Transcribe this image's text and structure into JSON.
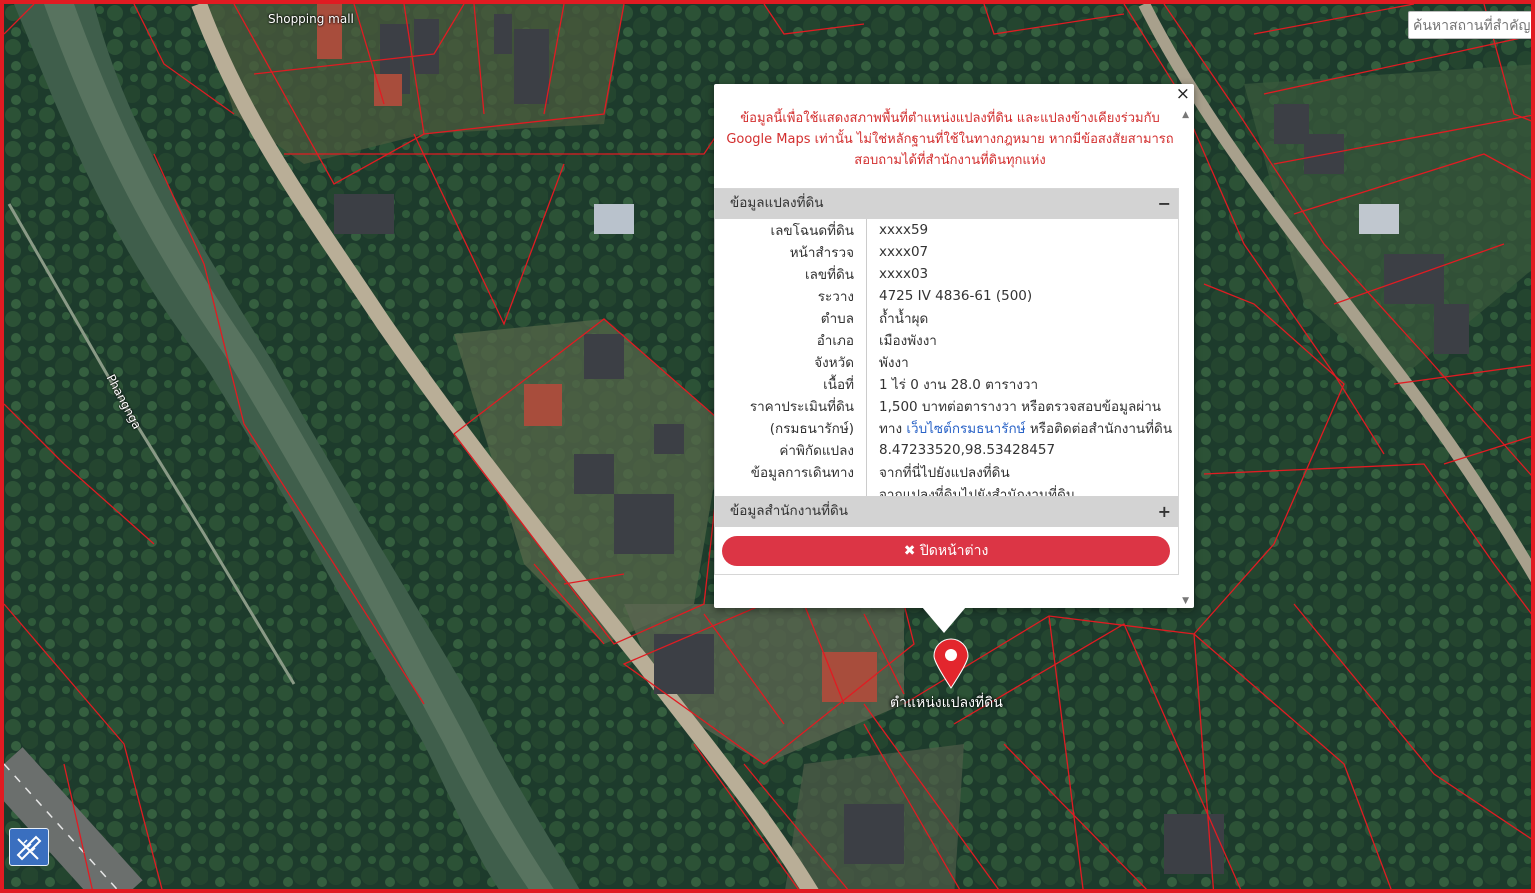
{
  "map": {
    "river_label": "Phangnga",
    "poi_label": "Shopping mall",
    "search_placeholder": "ค้นหาสถานที่สำคัญ",
    "pin_label": "ตำแหน่งแปลงที่ดิน",
    "colors": {
      "parcel_border": "#e11b22",
      "pin": "#e3262d",
      "tool_button": "#3a6fbf"
    }
  },
  "popup": {
    "disclaimer": "ข้อมูลนี้เพื่อใช้แสดงสภาพพื้นที่ตำแหน่งแปลงที่ดิน และแปลงข้างเคียงร่วมกับ Google Maps เท่านั้น ไม่ใช่หลักฐานที่ใช้ในทางกฎหมาย หากมีข้อสงสัยสามารถสอบถามได้ที่สำนักงานที่ดินทุกแห่ง",
    "section1_title": "ข้อมูลแปลงที่ดิน",
    "section1_sign": "−",
    "section2_title": "ข้อมูลสำนักงานที่ดิน",
    "section2_sign": "+",
    "close_button": "ปิดหน้าต่าง",
    "close_icon": "×",
    "close_button_icon": "✖",
    "rows": {
      "deed_no_label": "เลขโฉนดที่ดิน",
      "deed_no": "xxxx59",
      "survey_page_label": "หน้าสำรวจ",
      "survey_page": "xxxx07",
      "land_no_label": "เลขที่ดิน",
      "land_no": "xxxx03",
      "sheet_label": "ระวาง",
      "sheet": "4725 IV 4836-61 (500)",
      "subdistrict_label": "ตำบล",
      "subdistrict": "ถ้ำน้ำผุด",
      "district_label": "อำเภอ",
      "district": "เมืองพังงา",
      "province_label": "จังหวัด",
      "province": "พังงา",
      "area_label": "เนื้อที่",
      "area": "1 ไร่ 0 งาน 28.0 ตารางวา",
      "price_label_1": "ราคาประเมินที่ดิน",
      "price_label_2": "(กรมธนารักษ์)",
      "price_text_1": "1,500 บาทต่อตารางวา หรือตรวจสอบข้อมูลผ่าน",
      "price_text_2a": "ทาง",
      "price_link": "เว็บไซต์กรมธนารักษ์",
      "price_text_2b": "หรือติดต่อสำนักงานที่ดิน",
      "coord_label": "ค่าพิกัดแปลง",
      "coord": "8.47233520,98.53428457",
      "travel_label": "ข้อมูลการเดินทาง",
      "travel_link_1": "จากที่นี่ไปยังแปลงที่ดิน",
      "travel_link_2": "จากแปลงที่ดินไปยังสำนักงานที่ดิน"
    }
  }
}
